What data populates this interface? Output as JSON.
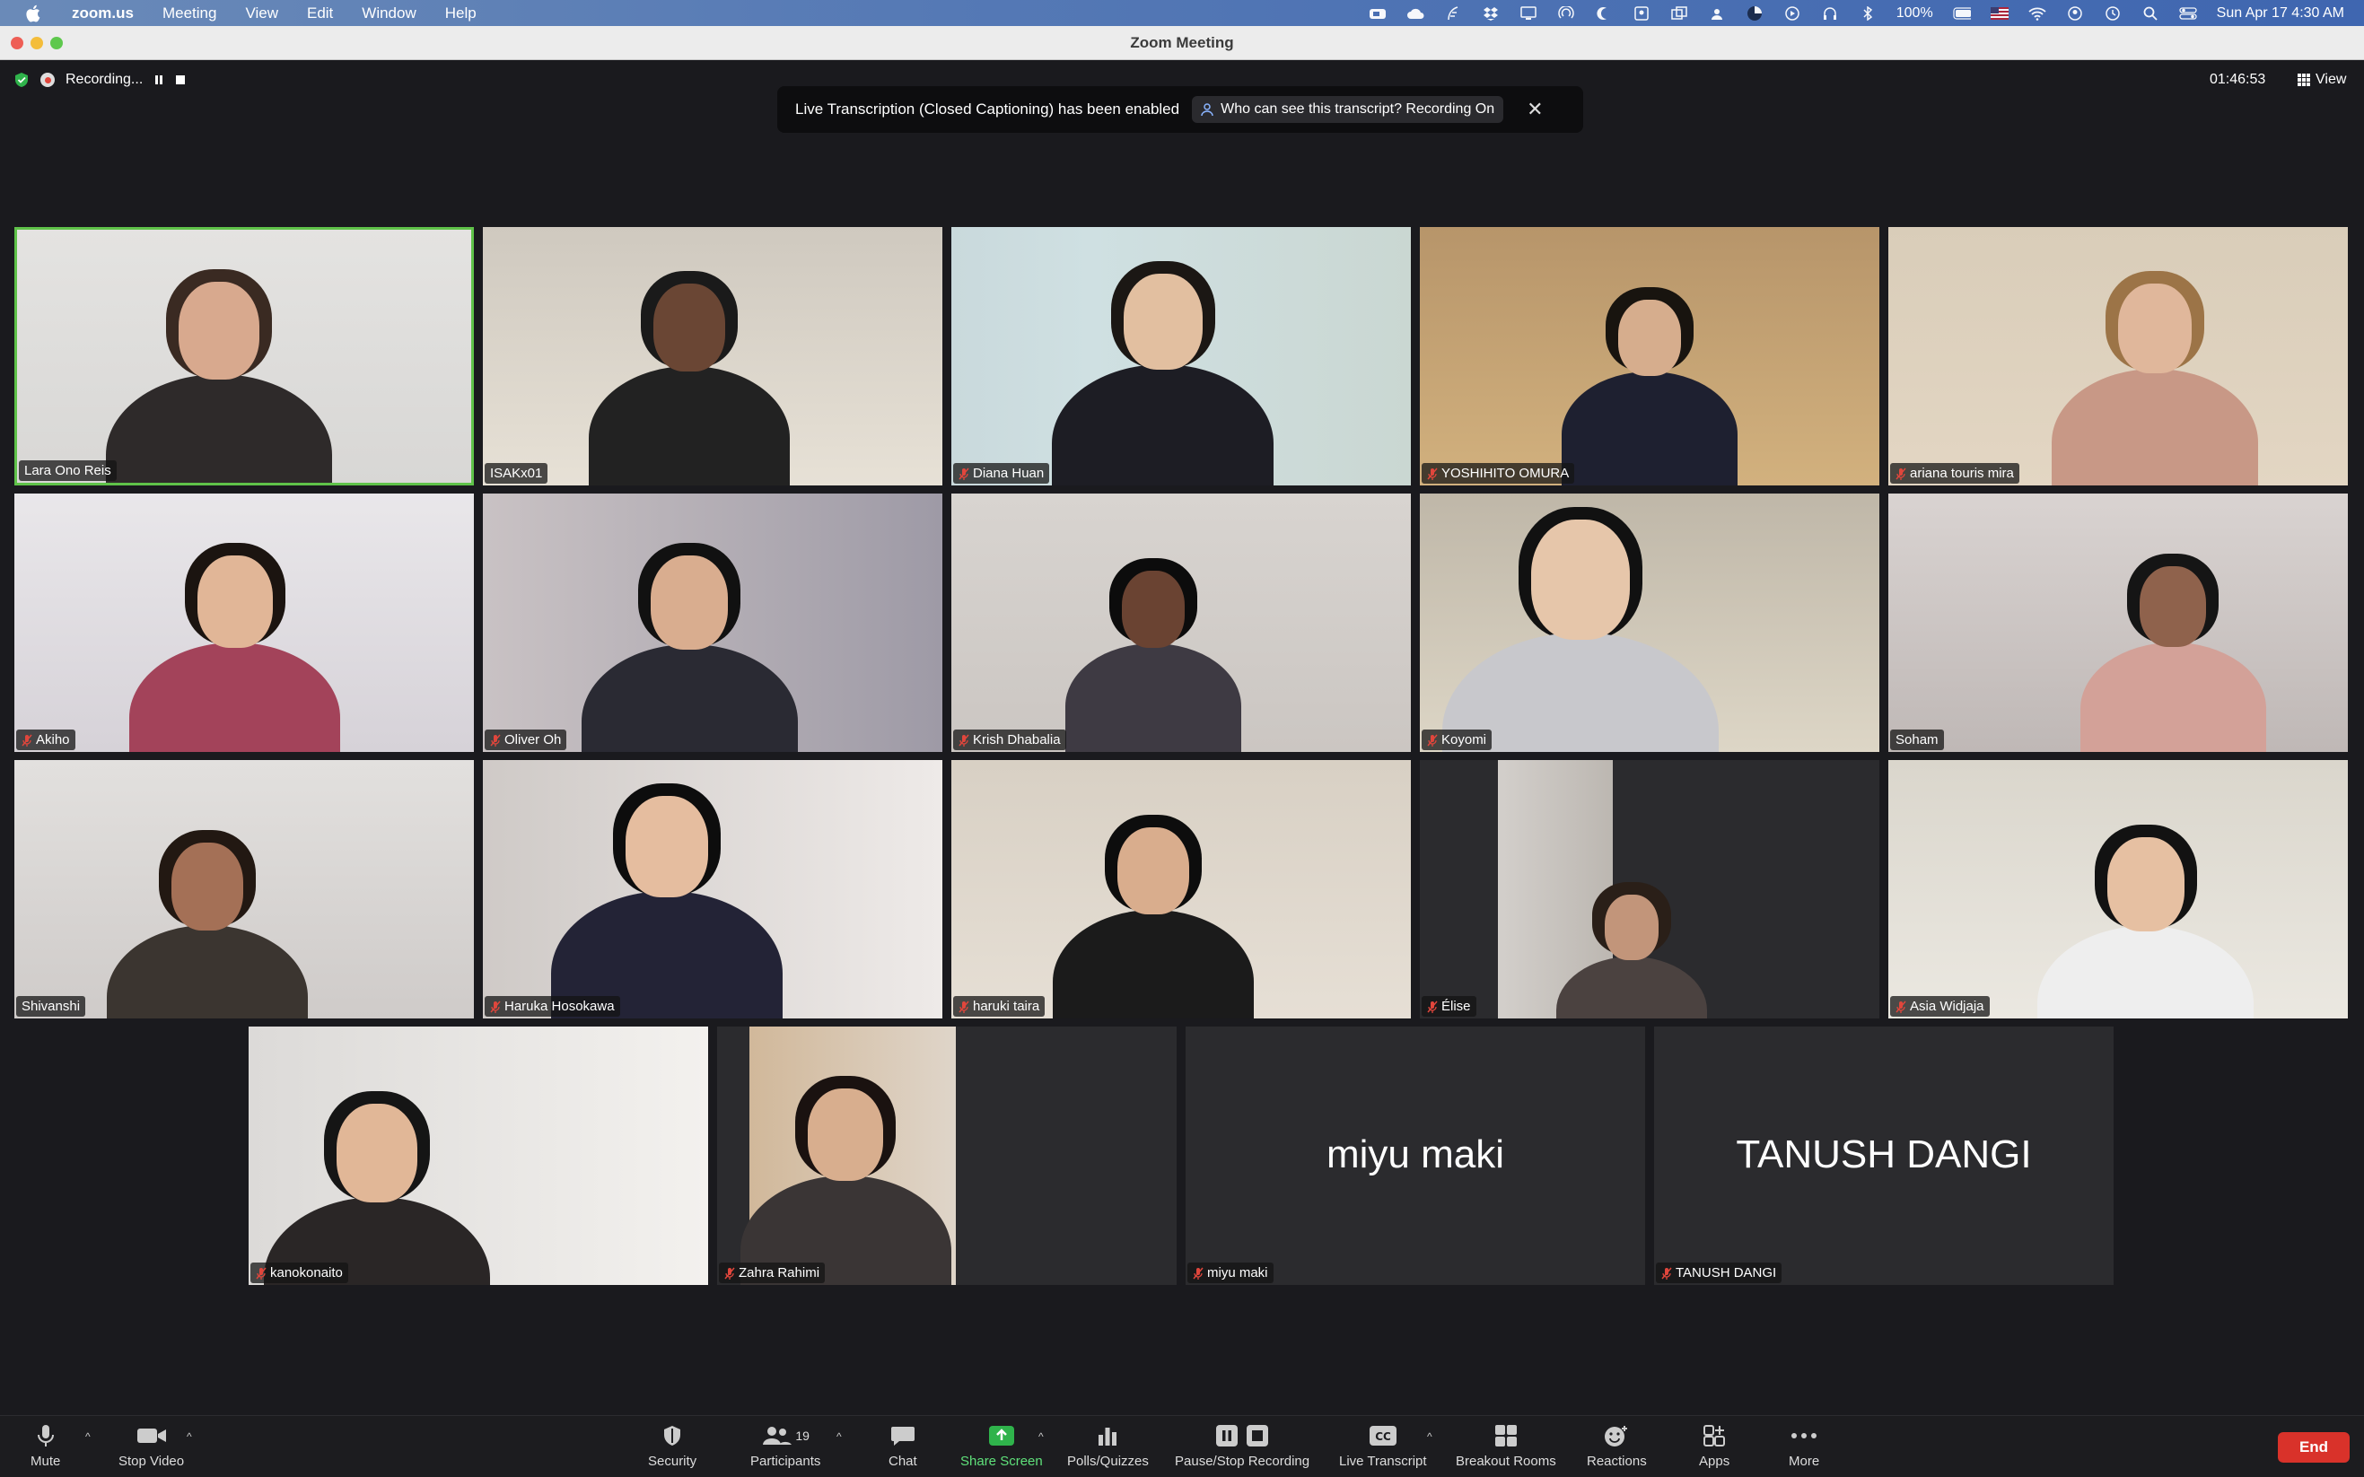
{
  "menubar": {
    "app_name": "zoom.us",
    "items": [
      "Meeting",
      "View",
      "Edit",
      "Window",
      "Help"
    ],
    "battery": "100%",
    "datetime": "Sun Apr 17  4:30 AM"
  },
  "window": {
    "title": "Zoom Meeting"
  },
  "recording": {
    "label": "Recording..."
  },
  "timer": "01:46:53",
  "view_label": "View",
  "banner": {
    "message": "Live Transcription (Closed Captioning) has been enabled",
    "who_label": "Who can see this transcript? Recording On"
  },
  "participants": [
    {
      "name": "Lara Ono Reis",
      "muted": false,
      "active": true
    },
    {
      "name": "ISAKx01",
      "muted": false
    },
    {
      "name": "Diana Huan",
      "muted": true
    },
    {
      "name": "YOSHIHITO OMURA",
      "muted": true
    },
    {
      "name": "ariana touris mira",
      "muted": true
    },
    {
      "name": "Akiho",
      "muted": true
    },
    {
      "name": "Oliver Oh",
      "muted": true
    },
    {
      "name": "Krish Dhabalia",
      "muted": true
    },
    {
      "name": "Koyomi",
      "muted": true
    },
    {
      "name": "Soham",
      "muted": false
    },
    {
      "name": "Shivanshi",
      "muted": false
    },
    {
      "name": "Haruka Hosokawa",
      "muted": true
    },
    {
      "name": "haruki taira",
      "muted": true
    },
    {
      "name": "Élise",
      "muted": true
    },
    {
      "name": "Asia Widjaja",
      "muted": true
    },
    {
      "name": "kanokonaito",
      "muted": true
    },
    {
      "name": "Zahra Rahimi",
      "muted": true
    },
    {
      "name": "miyu maki",
      "muted": true,
      "no_video": true
    },
    {
      "name": "TANUSH DANGI",
      "muted": true,
      "no_video": true
    }
  ],
  "toolbar": {
    "mute": "Mute",
    "stop_video": "Stop Video",
    "security": "Security",
    "participants": "Participants",
    "participants_count": "19",
    "chat": "Chat",
    "share_screen": "Share Screen",
    "polls": "Polls/Quizzes",
    "pause_recording": "Pause/Stop Recording",
    "live_transcript": "Live Transcript",
    "breakout": "Breakout Rooms",
    "reactions": "Reactions",
    "apps": "Apps",
    "more": "More",
    "end": "End"
  },
  "colors": {
    "accent_green": "#5fc249",
    "end_red": "#d9322a",
    "share_green": "#2fb34b"
  }
}
